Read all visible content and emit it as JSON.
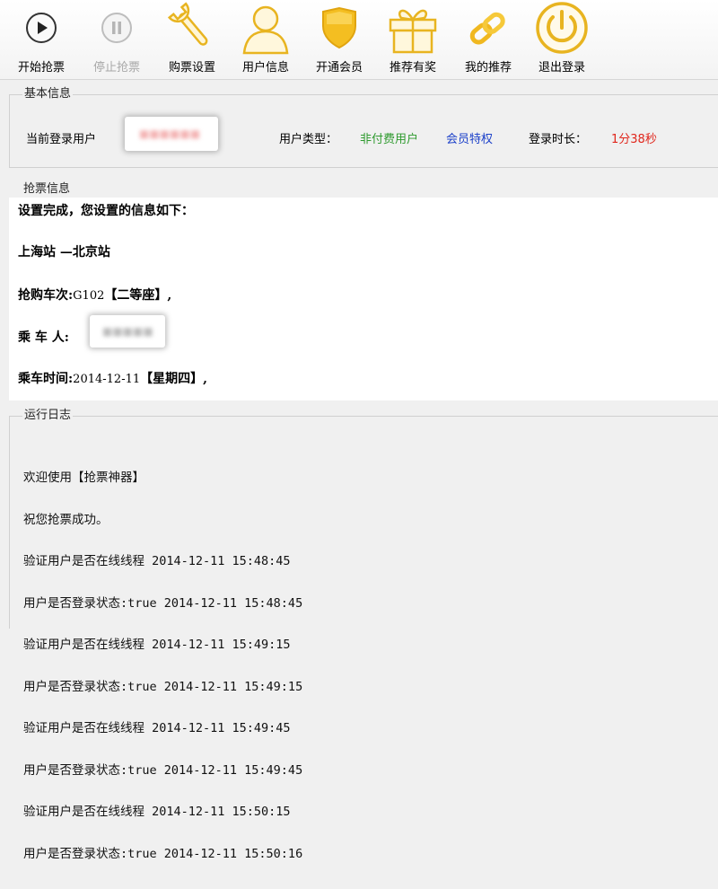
{
  "toolbar": {
    "items": [
      {
        "label": "开始抢票",
        "icon": "play-icon"
      },
      {
        "label": "停止抢票",
        "icon": "pause-icon"
      },
      {
        "label": "购票设置",
        "icon": "wrench-icon"
      },
      {
        "label": "用户信息",
        "icon": "user-icon"
      },
      {
        "label": "开通会员",
        "icon": "shield-icon"
      },
      {
        "label": "推荐有奖",
        "icon": "gift-icon"
      },
      {
        "label": "我的推荐",
        "icon": "link-icon"
      },
      {
        "label": "退出登录",
        "icon": "power-icon"
      }
    ]
  },
  "basic_info": {
    "title": "基本信息",
    "current_user_label": "当前登录用户",
    "user_type_label": "用户类型：",
    "user_type_value": "非付费用户",
    "vip_link": "会员特权",
    "login_duration_label": "登录时长：",
    "login_duration_value": "1分38秒"
  },
  "ticket_info": {
    "title": "抢票信息",
    "intro": "设置完成，您设置的信息如下：",
    "route": "上海站 —北京站",
    "train_label": "抢购车次:",
    "train_value": "G102",
    "train_suffix": "【二等座】,",
    "passenger_label": "乘 车 人:",
    "date_label": "乘车时间:",
    "date_value": "2014-12-11",
    "date_suffix": "【星期四】,"
  },
  "log": {
    "title": "运行日志",
    "lines": [
      "欢迎使用【抢票神器】",
      "祝您抢票成功。",
      "验证用户是否在线线程 2014-12-11 15:48:45",
      "用户是否登录状态:true 2014-12-11 15:48:45",
      "验证用户是否在线线程 2014-12-11 15:49:15",
      "用户是否登录状态:true 2014-12-11 15:49:15",
      "验证用户是否在线线程 2014-12-11 15:49:45",
      "用户是否登录状态:true 2014-12-11 15:49:45",
      "验证用户是否在线线程 2014-12-11 15:50:15",
      "用户是否登录状态:true 2014-12-11 15:50:16"
    ]
  },
  "colors": {
    "green": "#2e9a2e",
    "blue": "#1a3fc9",
    "red": "#e0261c",
    "gold": "#f2c12e"
  }
}
